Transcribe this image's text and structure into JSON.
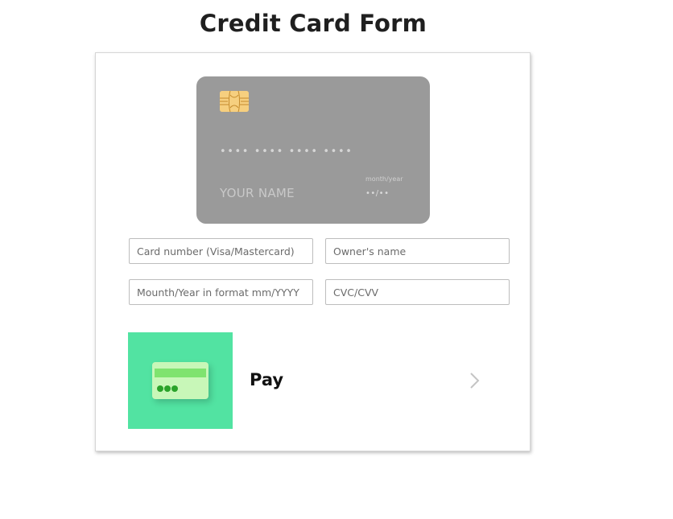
{
  "page": {
    "title": "Credit Card Form"
  },
  "card_preview": {
    "chip_icon": "chip-icon",
    "number_mask": "•••• •••• •••• ••••",
    "name_placeholder": "YOUR NAME",
    "expiry_label": "month/year",
    "expiry_mask": "••/••",
    "background_color": "#9a9a9a"
  },
  "form": {
    "card_number": {
      "value": "",
      "placeholder": "Card number (Visa/Mastercard)"
    },
    "owner_name": {
      "value": "",
      "placeholder": "Owner's name"
    },
    "expiry": {
      "value": "",
      "placeholder": "Mounth/Year in format mm/YYYY"
    },
    "cvc": {
      "value": "",
      "placeholder": "CVC/CVV"
    }
  },
  "pay_button": {
    "label": "Pay",
    "icon": "credit-card-icon",
    "arrow_icon": "chevron-right-icon",
    "accent_color": "#52e3a2"
  }
}
